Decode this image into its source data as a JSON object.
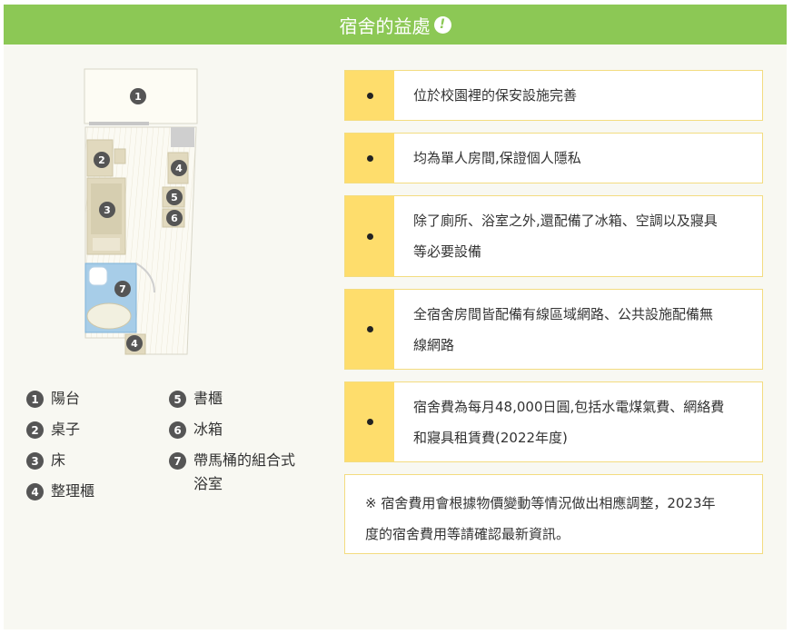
{
  "header": {
    "title": "宿舍的益處",
    "icon": "exclamation-icon"
  },
  "plan_numbers": [
    "1",
    "2",
    "3",
    "4",
    "5",
    "6",
    "7",
    "4"
  ],
  "legend": [
    {
      "num": "1",
      "label": "陽台"
    },
    {
      "num": "2",
      "label": "桌子"
    },
    {
      "num": "3",
      "label": "床"
    },
    {
      "num": "4",
      "label": "整理櫃"
    },
    {
      "num": "5",
      "label": "書櫃"
    },
    {
      "num": "6",
      "label": "冰箱"
    },
    {
      "num": "7",
      "label": "帶馬桶的組合式浴室"
    }
  ],
  "legend_7_lines": [
    "帶馬桶的組合式",
    "浴室"
  ],
  "benefits": [
    {
      "lines": [
        "位於校園裡的保安設施完善"
      ]
    },
    {
      "lines": [
        "均為單人房間,保證個人隱私"
      ]
    },
    {
      "lines": [
        "除了廁所、浴室之外,還配備了冰箱、空調以及寢具",
        "等必要設備"
      ]
    },
    {
      "lines": [
        "全宿舍房間皆配備有線區域網路、公共設施配備無",
        "線網路"
      ]
    },
    {
      "lines": [
        "宿舍費為每月48,000日圓,包括水電煤氣費、網絡費",
        "和寢具租賃費(2022年度)"
      ]
    }
  ],
  "note_lines": [
    "※ 宿舍費用會根據物價變動等情況做出相應調整，2023年",
    "度的宿舍費用等請確認最新資訊。"
  ],
  "colors": {
    "header": "#8cc855",
    "bullet": "#fedd6c",
    "border": "#f3dc80",
    "background": "#f8f8f2"
  }
}
